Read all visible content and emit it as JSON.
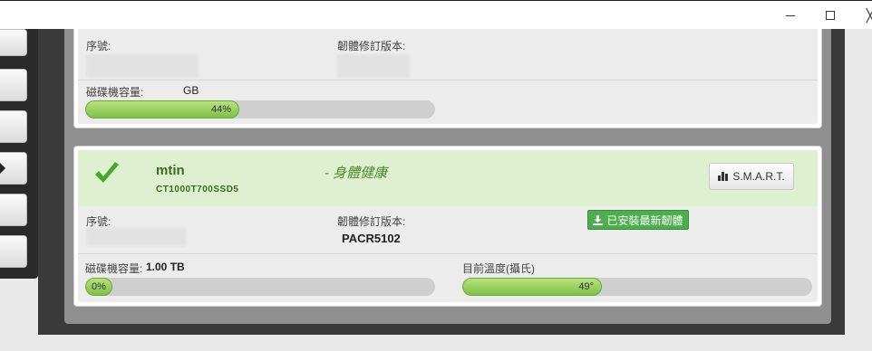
{
  "window": {
    "controls": {
      "minimize_icon": "minimize-icon",
      "maximize_icon": "maximize-icon",
      "close_label": "╳"
    }
  },
  "drive1": {
    "serial_label": "序號:",
    "firmware_label": "韌體修訂版本:",
    "capacity_label": "磁碟機容量:",
    "capacity_value": "GB",
    "usage_percent": 44,
    "usage_text": "44%"
  },
  "drive2": {
    "name": "mtin",
    "model": "CT1000T700SSD5",
    "health": "- 身體健康",
    "smart_label": "S.M.A.R.T.",
    "serial_label": "序號:",
    "firmware_label": "韌體修訂版本:",
    "firmware_value": "PACR5102",
    "firmware_button": "已安裝最新韌體",
    "capacity_label": "磁碟機容量:",
    "capacity_value": "1.00 TB",
    "usage_percent": 0,
    "usage_text": "0%",
    "temp_label": "目前溫度(攝氏)",
    "temp_value": 49,
    "temp_text": "49°",
    "temp_fraction": 0.4,
    "status_color": "#4cae4c"
  }
}
